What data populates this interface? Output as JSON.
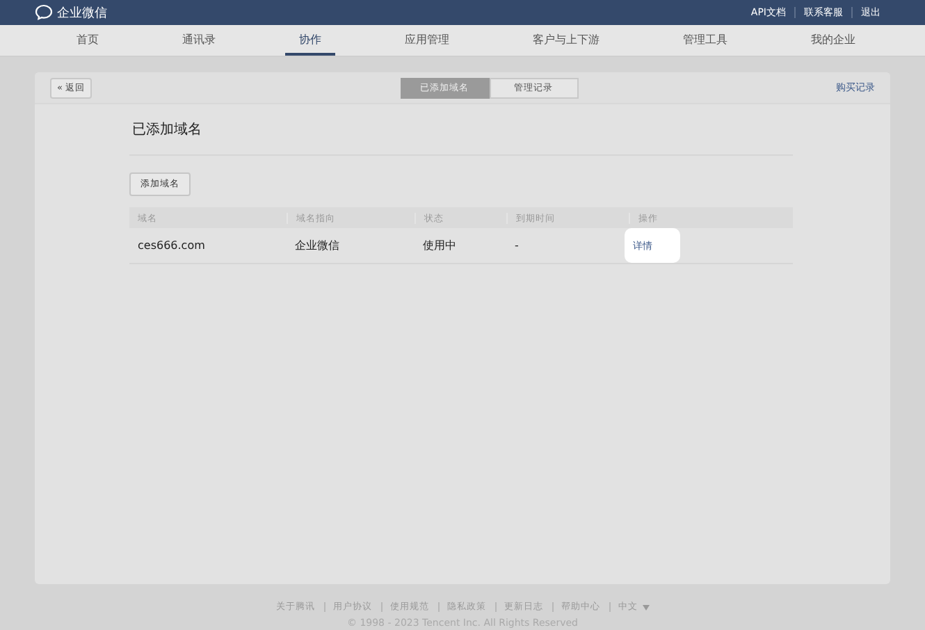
{
  "header": {
    "brand": "企业微信",
    "links": [
      "API文档",
      "联系客服",
      "退出"
    ]
  },
  "nav": [
    {
      "label": "首页",
      "selected": false
    },
    {
      "label": "通讯录",
      "selected": false
    },
    {
      "label": "协作",
      "selected": true
    },
    {
      "label": "应用管理",
      "selected": false
    },
    {
      "label": "客户与上下游",
      "selected": false
    },
    {
      "label": "管理工具",
      "selected": false
    },
    {
      "label": "我的企业",
      "selected": false
    }
  ],
  "toolbar": {
    "back": "« 返回",
    "tabs": [
      {
        "label": "已添加域名",
        "selected": true
      },
      {
        "label": "管理记录",
        "selected": false
      }
    ],
    "link": "购买记录"
  },
  "section": {
    "title": "已添加域名",
    "add_button": "添加域名"
  },
  "table": {
    "columns": [
      "域名",
      "域名指向",
      "状态",
      "到期时间",
      "操作"
    ],
    "rows": [
      {
        "cells": [
          "ces666.com",
          "企业微信",
          "使用中",
          "-"
        ],
        "action": "详情",
        "highlighted": true
      }
    ]
  },
  "footer": {
    "links": [
      "关于腾讯",
      "用户协议",
      "使用规范",
      "隐私政策",
      "更新日志",
      "帮助中心"
    ],
    "language": "中文",
    "copyright": "© 1998 - 2023 Tencent Inc. All Rights Reserved"
  }
}
